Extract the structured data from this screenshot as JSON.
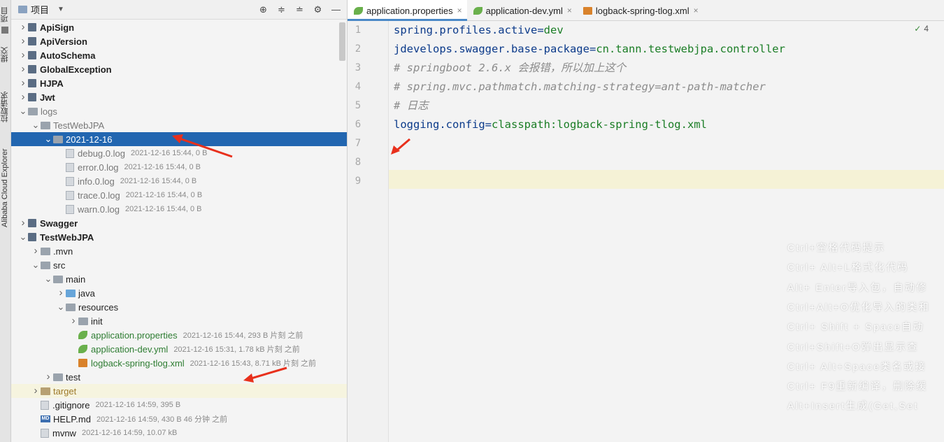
{
  "sidebar_strip": {
    "items": [
      "项目",
      "提交",
      "拉取请求",
      "Alibaba Cloud Explorer"
    ]
  },
  "project_panel": {
    "title": "项目",
    "tools": [
      "locate-icon",
      "expand-all-icon",
      "collapse-all-icon",
      "gear-icon",
      "minimize-icon"
    ],
    "tree": [
      {
        "name": "ApiSign",
        "meta": "",
        "level": 1,
        "expanded": false,
        "type": "module"
      },
      {
        "name": "ApiVersion",
        "meta": "",
        "level": 1,
        "expanded": false,
        "type": "module"
      },
      {
        "name": "AutoSchema",
        "meta": "",
        "level": 1,
        "expanded": false,
        "type": "module"
      },
      {
        "name": "GlobalException",
        "meta": "",
        "level": 1,
        "expanded": false,
        "type": "module"
      },
      {
        "name": "HJPA",
        "meta": "",
        "level": 1,
        "expanded": false,
        "type": "module"
      },
      {
        "name": "Jwt",
        "meta": "",
        "level": 1,
        "expanded": false,
        "type": "module"
      },
      {
        "name": "logs",
        "meta": "",
        "level": 1,
        "expanded": true,
        "type": "folder"
      },
      {
        "name": "TestWebJPA",
        "meta": "",
        "level": 2,
        "expanded": true,
        "type": "folder"
      },
      {
        "name": "2021-12-16",
        "meta": "",
        "level": 3,
        "expanded": true,
        "type": "folder",
        "selected": true
      },
      {
        "name": "debug.0.log",
        "meta": "2021-12-16 15:44, 0 B",
        "level": 4,
        "type": "file"
      },
      {
        "name": "error.0.log",
        "meta": "2021-12-16 15:44, 0 B",
        "level": 4,
        "type": "file"
      },
      {
        "name": "info.0.log",
        "meta": "2021-12-16 15:44, 0 B",
        "level": 4,
        "type": "file"
      },
      {
        "name": "trace.0.log",
        "meta": "2021-12-16 15:44, 0 B",
        "level": 4,
        "type": "file"
      },
      {
        "name": "warn.0.log",
        "meta": "2021-12-16 15:44, 0 B",
        "level": 4,
        "type": "file"
      },
      {
        "name": "Swagger",
        "meta": "",
        "level": 1,
        "expanded": false,
        "type": "module"
      },
      {
        "name": "TestWebJPA",
        "meta": "",
        "level": 1,
        "expanded": true,
        "type": "module"
      },
      {
        "name": ".mvn",
        "meta": "",
        "level": 2,
        "expanded": false,
        "type": "folder"
      },
      {
        "name": "src",
        "meta": "",
        "level": 2,
        "expanded": true,
        "type": "folder"
      },
      {
        "name": "main",
        "meta": "",
        "level": 3,
        "expanded": true,
        "type": "folder"
      },
      {
        "name": "java",
        "meta": "",
        "level": 4,
        "expanded": false,
        "type": "source"
      },
      {
        "name": "resources",
        "meta": "",
        "level": 4,
        "expanded": true,
        "type": "resources"
      },
      {
        "name": "init",
        "meta": "",
        "level": 5,
        "expanded": false,
        "type": "folder"
      },
      {
        "name": "application.properties",
        "meta": "2021-12-16 15:44, 293 B 片刻 之前",
        "level": 5,
        "type": "spring"
      },
      {
        "name": "application-dev.yml",
        "meta": "2021-12-16 15:31, 1.78 kB 片刻 之前",
        "level": 5,
        "type": "spring"
      },
      {
        "name": "logback-spring-tlog.xml",
        "meta": "2021-12-16 15:43, 8.71 kB 片刻 之前",
        "level": 5,
        "type": "xml"
      },
      {
        "name": "test",
        "meta": "",
        "level": 3,
        "expanded": false,
        "type": "folder"
      },
      {
        "name": "target",
        "meta": "",
        "level": 2,
        "expanded": false,
        "type": "excluded",
        "highlight": true
      },
      {
        "name": ".gitignore",
        "meta": "2021-12-16 14:59, 395 B",
        "level": 2,
        "type": "file"
      },
      {
        "name": "HELP.md",
        "meta": "2021-12-16 14:59, 430 B 46 分钟 之前",
        "level": 2,
        "type": "md"
      },
      {
        "name": "mvnw",
        "meta": "2021-12-16 14:59, 10.07 kB",
        "level": 2,
        "type": "file"
      }
    ]
  },
  "editor": {
    "tabs": [
      {
        "label": "application.properties",
        "icon": "spring-leaf-icon",
        "active": true
      },
      {
        "label": "application-dev.yml",
        "icon": "spring-leaf-icon",
        "active": false
      },
      {
        "label": "logback-spring-tlog.xml",
        "icon": "xml-file-icon",
        "active": false
      }
    ],
    "inspection_count": "4",
    "line_numbers": [
      "1",
      "2",
      "3",
      "4",
      "5",
      "6",
      "7",
      "8",
      "9"
    ],
    "lines": [
      {
        "key": "spring.profiles.active",
        "eq": "=",
        "value": "dev",
        "comment": ""
      },
      {
        "key": "jdevelops.swagger.base-package",
        "eq": "=",
        "value": "cn.tann.testwebjpa.controller",
        "comment": ""
      },
      {
        "key": "",
        "eq": "",
        "value": "",
        "comment": "# springboot 2.6.x 会报错，所以加上这个"
      },
      {
        "key": "",
        "eq": "",
        "value": "",
        "comment": "# spring.mvc.pathmatch.matching-strategy=ant-path-matcher"
      },
      {
        "key": "",
        "eq": "",
        "value": "",
        "comment": "# 日志"
      },
      {
        "key": "logging.config",
        "eq": "=",
        "value": "classpath:logback-spring-tlog.xml",
        "comment": ""
      },
      {
        "key": "",
        "eq": "",
        "value": "",
        "comment": ""
      },
      {
        "key": "",
        "eq": "",
        "value": "",
        "comment": ""
      },
      {
        "key": "",
        "eq": "",
        "value": "",
        "comment": ""
      }
    ]
  },
  "background_hints": [
    "Ctrl+空格代码提示",
    "Ctrl+ Alt+L格式化代码",
    "Alt+ Enter导入包，自动修",
    "Ctrl+Alt+O优化导入的类和",
    "Ctrl+ Shift + Space自动",
    "Ctrl+Shift+O弹出显示查",
    "Ctrl+ Alt+Space类名或接",
    "Ctrl+ F9重新编译，删除缓",
    "Alt+Insert生成(Get,Set"
  ],
  "colors": {
    "selection": "#2266b0",
    "annotation_arrow": "#e8301c",
    "property_key": "#0b3a8a",
    "property_value": "#1a7d25",
    "comment": "#8c8c8c"
  }
}
